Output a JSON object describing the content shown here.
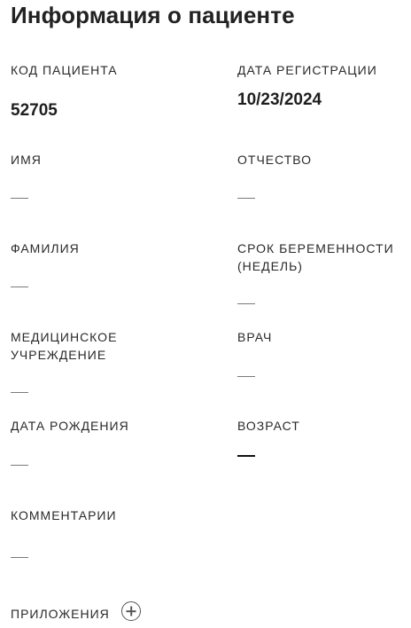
{
  "page": {
    "title": "Информация о пациенте"
  },
  "fields": {
    "patient_code": {
      "label": "КОД ПАЦИЕНТА",
      "value": "52705"
    },
    "registration_date": {
      "label": "ДАТА РЕГИСТРАЦИИ",
      "value": "10/23/2024"
    },
    "first_name": {
      "label": "ИМЯ",
      "value": "—"
    },
    "patronymic": {
      "label": "ОТЧЕСТВО",
      "value": "—"
    },
    "last_name": {
      "label": "ФАМИЛИЯ",
      "value": "—"
    },
    "pregnancy_term": {
      "label": "СРОК БЕРЕМЕННОСТИ (НЕДЕЛЬ)",
      "value": "—"
    },
    "medical_facility": {
      "label": "МЕДИЦИНСКОЕ УЧРЕЖДЕНИЕ",
      "value": "—"
    },
    "doctor": {
      "label": "ВРАЧ",
      "value": "—"
    },
    "birth_date": {
      "label": "ДАТА РОЖДЕНИЯ",
      "value": "—"
    },
    "age": {
      "label": "ВОЗРАСТ",
      "value": "—"
    },
    "comments": {
      "label": "КОММЕНТАРИИ",
      "value": "—"
    }
  },
  "attachments": {
    "label": "ПРИЛОЖЕНИЯ",
    "add_icon": "plus-circle-icon"
  }
}
